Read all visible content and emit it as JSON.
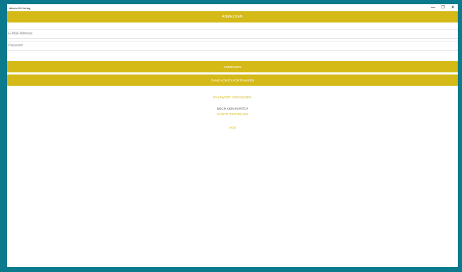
{
  "window": {
    "title": "alkodo Kit Verlag"
  },
  "header": {
    "title": "ANMELDEN"
  },
  "form": {
    "email_placeholder": "E-Mail-Adresse",
    "password_placeholder": "Passwort",
    "login_label": "ANMELDEN",
    "guest_label": "OHNE KONTO FORTFAHREN"
  },
  "links": {
    "forgot_password": "PASSWORT VERGESSEN",
    "no_account": "NOCH KEIN KONTO?",
    "create_account": "KONTO ERSTELLEN",
    "agb": "AGB"
  },
  "colors": {
    "accent": "#d4b917",
    "background": "#0a7a8c"
  }
}
